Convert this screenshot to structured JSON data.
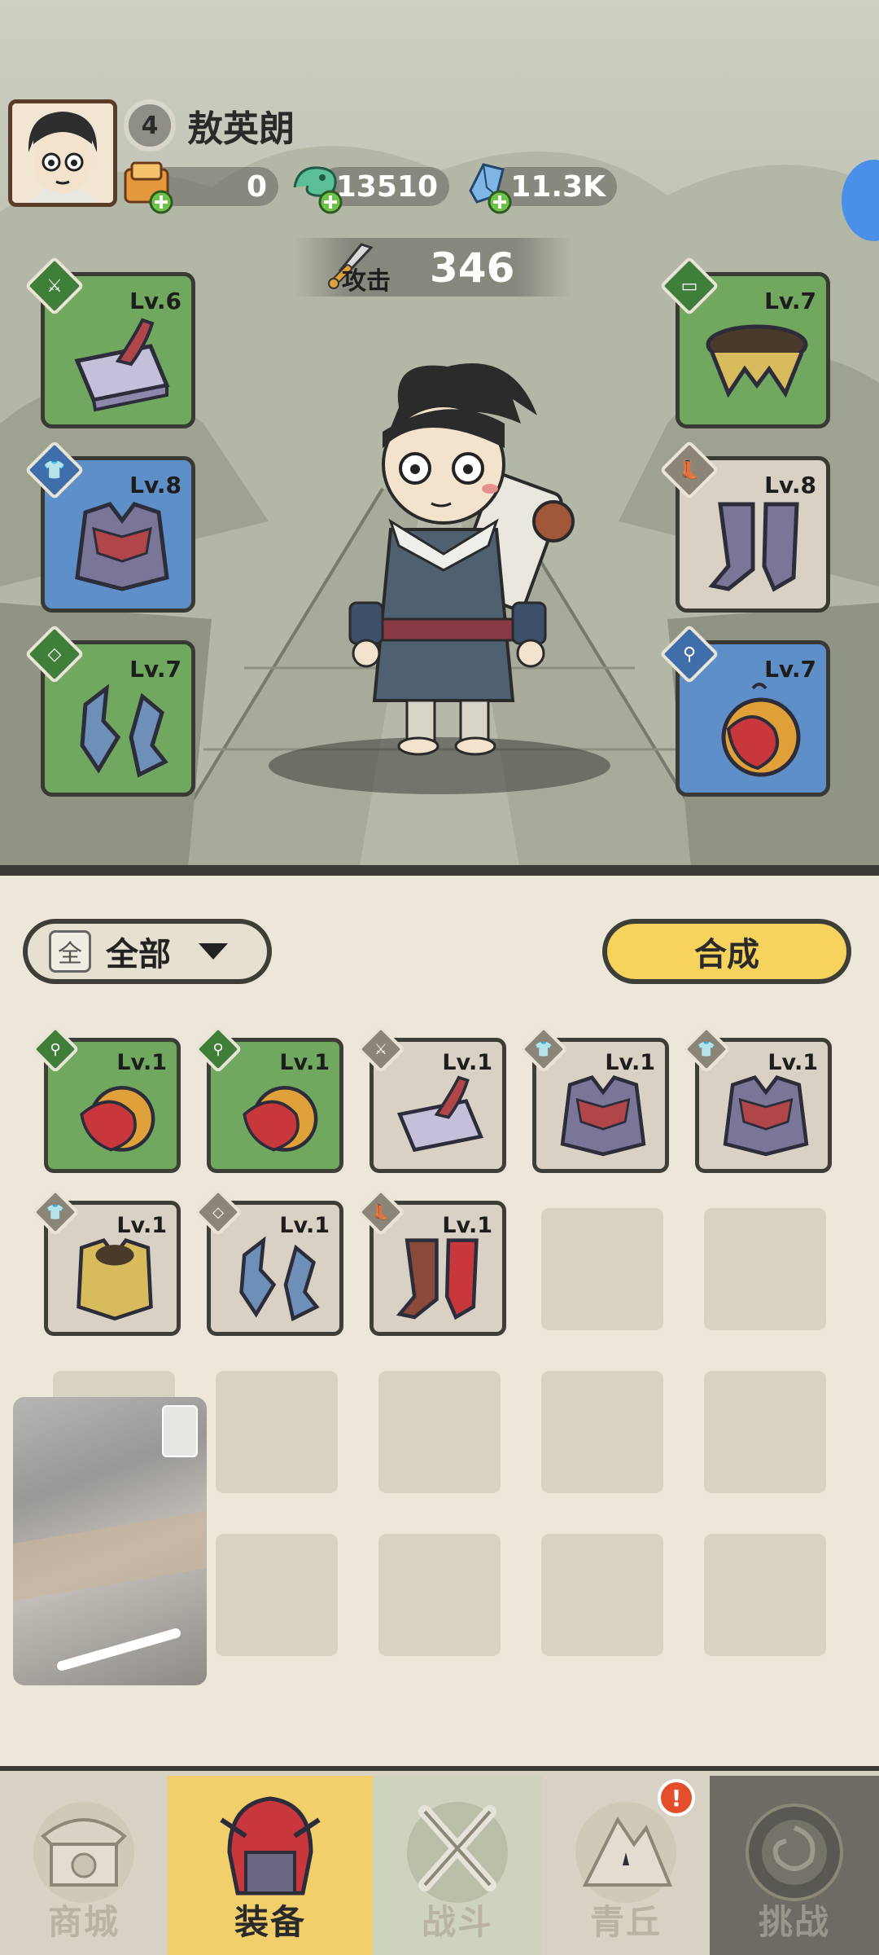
{
  "header": {
    "level": "4",
    "player_name": "敖英朗",
    "resources": [
      {
        "name": "scroll",
        "value": "0"
      },
      {
        "name": "jade-dragon",
        "value": "13510"
      },
      {
        "name": "crystal",
        "value": "11.3K"
      }
    ],
    "attack_label": "攻击",
    "attack_value": "346"
  },
  "equipped": {
    "left": [
      {
        "level": "Lv.6",
        "type": "weapon",
        "rarity": "green"
      },
      {
        "level": "Lv.8",
        "type": "armor",
        "rarity": "blue"
      },
      {
        "level": "Lv.7",
        "type": "bracers",
        "rarity": "green"
      }
    ],
    "right": [
      {
        "level": "Lv.7",
        "type": "belt",
        "rarity": "green"
      },
      {
        "level": "Lv.8",
        "type": "boots",
        "rarity": "grey"
      },
      {
        "level": "Lv.7",
        "type": "amulet",
        "rarity": "blue"
      }
    ]
  },
  "inventory": {
    "filter_icon_text": "全",
    "filter_label": "全部",
    "synthesize_label": "合成",
    "items": [
      {
        "level": "Lv.1",
        "type": "amulet",
        "rarity": "green"
      },
      {
        "level": "Lv.1",
        "type": "amulet",
        "rarity": "green"
      },
      {
        "level": "Lv.1",
        "type": "weapon",
        "rarity": "grey"
      },
      {
        "level": "Lv.1",
        "type": "armor",
        "rarity": "grey"
      },
      {
        "level": "Lv.1",
        "type": "armor",
        "rarity": "grey"
      },
      {
        "level": "Lv.1",
        "type": "armor",
        "rarity": "grey"
      },
      {
        "level": "Lv.1",
        "type": "bracers",
        "rarity": "grey"
      },
      {
        "level": "Lv.1",
        "type": "boots",
        "rarity": "grey"
      }
    ]
  },
  "nav": {
    "items": [
      {
        "label": "商城",
        "icon": "shop-icon"
      },
      {
        "label": "装备",
        "icon": "helmet-icon"
      },
      {
        "label": "战斗",
        "icon": "crossed-swords-icon"
      },
      {
        "label": "青丘",
        "icon": "mountain-icon"
      },
      {
        "label": "挑战",
        "icon": "vortex-icon"
      }
    ],
    "badge": "!"
  },
  "colors": {
    "green_rarity": "#6fa85e",
    "blue_rarity": "#5f8fc9",
    "grey_rarity": "#d9d2c4",
    "accent_yellow": "#f6d35c"
  }
}
